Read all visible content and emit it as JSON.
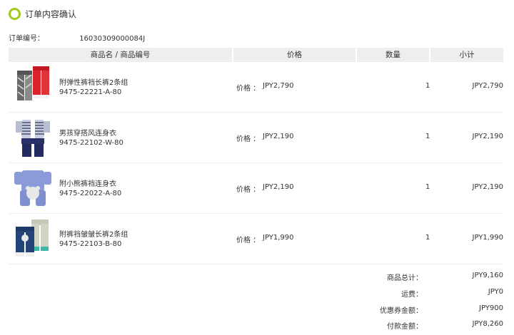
{
  "title": "订单内容确认",
  "order": {
    "label": "订单编号：",
    "number": "16030309000084J"
  },
  "table": {
    "headers": [
      "商品名 / 商品编号",
      "价格",
      "数量",
      "小计"
    ],
    "price_label": "价格 ：",
    "rows": [
      {
        "name": "附弹性裤裆长裤2条组",
        "code": "9475-22221-A-80",
        "price": "JPY2,790",
        "qty": "1",
        "subtotal": "JPY2,790",
        "image": "pants-set-icon"
      },
      {
        "name": "男孩穿搭风连身衣",
        "code": "9475-22102-W-80",
        "price": "JPY2,190",
        "qty": "1",
        "subtotal": "JPY2,190",
        "image": "romper-vest-icon"
      },
      {
        "name": "附小熊裤裆连身衣",
        "code": "9475-22022-A-80",
        "price": "JPY2,190",
        "qty": "1",
        "subtotal": "JPY2,190",
        "image": "bear-romper-icon"
      },
      {
        "name": "附裤裆皱皱长裤2条组",
        "code": "9475-22103-B-80",
        "price": "JPY1,990",
        "qty": "1",
        "subtotal": "JPY1,990",
        "image": "pants-pair-icon"
      }
    ]
  },
  "summary": [
    {
      "label": "商品总计：",
      "value": "JPY9,160"
    },
    {
      "label": "运费：",
      "value": "JPY0"
    },
    {
      "label": "优惠券金额：",
      "value": "JPY900"
    },
    {
      "label": "付款金额：",
      "value": "JPY8,260"
    }
  ],
  "colors": {
    "accent": "#a2c81a",
    "header_bg": "#eeeeee"
  }
}
